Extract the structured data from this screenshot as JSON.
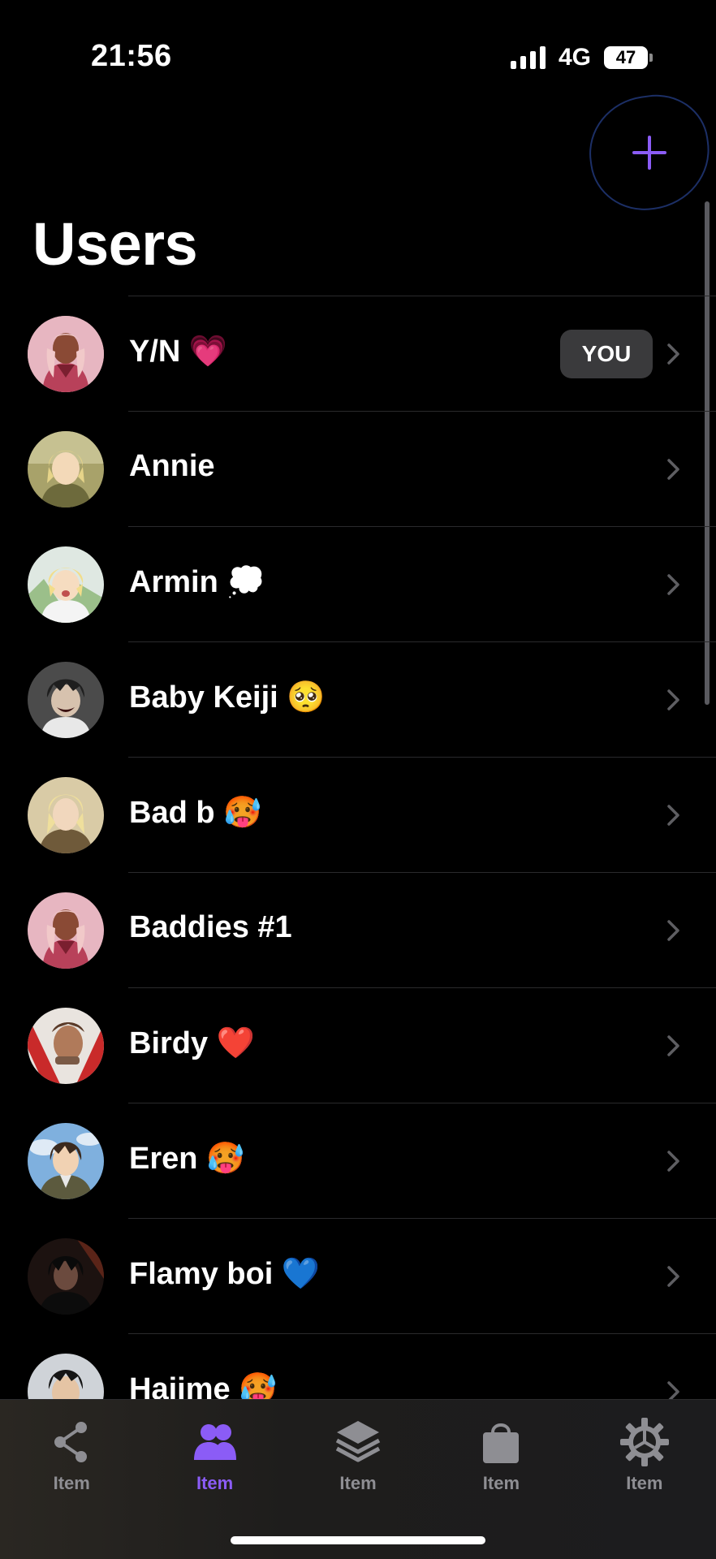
{
  "status_bar": {
    "time": "21:56",
    "network": "4G",
    "battery": "47"
  },
  "header": {
    "title": "Users",
    "add_icon": "plus-icon",
    "accent_color": "#8b5cf6"
  },
  "users": [
    {
      "name": "Y/N 💗",
      "badge": "YOU"
    },
    {
      "name": "Annie"
    },
    {
      "name": "Armin 💭"
    },
    {
      "name": "Baby Keiji 🥺"
    },
    {
      "name": "Bad b 🥵"
    },
    {
      "name": "Baddies #1"
    },
    {
      "name": "Birdy ❤️"
    },
    {
      "name": "Eren 🥵"
    },
    {
      "name": "Flamy boi 💙"
    },
    {
      "name": "Hajime 🥵"
    }
  ],
  "tab_bar": {
    "tabs": [
      {
        "label": "Item",
        "icon": "share-icon",
        "active": false
      },
      {
        "label": "Item",
        "icon": "users-icon",
        "active": true
      },
      {
        "label": "Item",
        "icon": "layers-icon",
        "active": false
      },
      {
        "label": "Item",
        "icon": "shopping-bag-icon",
        "active": false
      },
      {
        "label": "Item",
        "icon": "gear-icon",
        "active": false
      }
    ]
  }
}
